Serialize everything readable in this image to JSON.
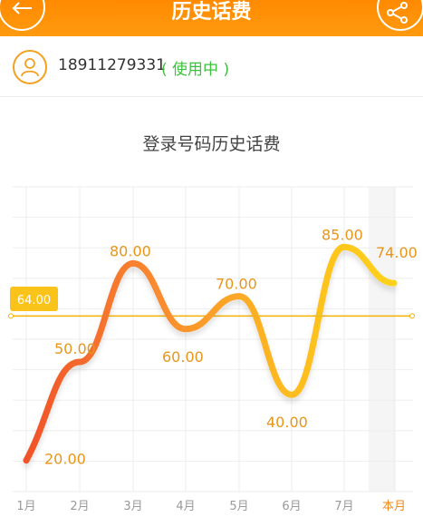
{
  "header": {
    "title": "历史话费",
    "back_icon": "back-arrow-icon",
    "share_icon": "share-icon"
  },
  "user": {
    "phone": "18911279331",
    "status": "( 使用中 )",
    "avatar_icon": "user-avatar-icon"
  },
  "colors": {
    "accent": "#ff8c00",
    "status_green": "#3cc23c",
    "line_start": "#f0522a",
    "line_end": "#ffd21a",
    "avg_line": "#f5b000"
  },
  "chart_data": {
    "type": "line",
    "title": "登录号码历史话费",
    "categories": [
      "1月",
      "2月",
      "3月",
      "4月",
      "5月",
      "6月",
      "7月",
      "本月"
    ],
    "values": [
      20.0,
      50.0,
      80.0,
      60.0,
      70.0,
      40.0,
      85.0,
      74.0
    ],
    "value_labels": [
      "20.00",
      "50.00",
      "80.00",
      "60.00",
      "70.00",
      "40.00",
      "85.00",
      "74.00"
    ],
    "average": 64.0,
    "average_label": "64.00",
    "ylim": [
      0,
      100
    ],
    "highlighted_category": "本月",
    "grid": true
  }
}
